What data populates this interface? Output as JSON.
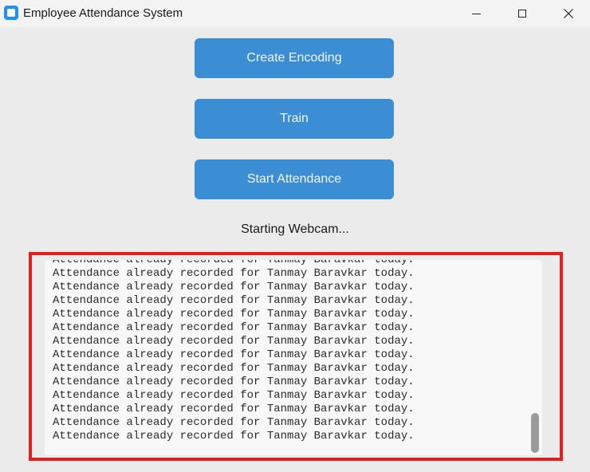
{
  "window": {
    "title": "Employee Attendance System",
    "icons": [
      "app-icon",
      "minimize-icon",
      "maximize-icon",
      "close-icon"
    ]
  },
  "buttons": {
    "create_encoding": "Create Encoding",
    "train": "Train",
    "start_attendance": "Start Attendance"
  },
  "status": "Starting Webcam...",
  "log": {
    "lines": [
      "Attendance already recorded for Tanmay Baravkar today.",
      "Attendance already recorded for Tanmay Baravkar today.",
      "Attendance already recorded for Tanmay Baravkar today.",
      "Attendance already recorded for Tanmay Baravkar today.",
      "Attendance already recorded for Tanmay Baravkar today.",
      "Attendance already recorded for Tanmay Baravkar today.",
      "Attendance already recorded for Tanmay Baravkar today.",
      "Attendance already recorded for Tanmay Baravkar today.",
      "Attendance already recorded for Tanmay Baravkar today.",
      "Attendance already recorded for Tanmay Baravkar today.",
      "Attendance already recorded for Tanmay Baravkar today.",
      "Attendance already recorded for Tanmay Baravkar today.",
      "Attendance already recorded for Tanmay Baravkar today.",
      "Attendance already recorded for Tanmay Baravkar today."
    ]
  },
  "colors": {
    "button": "#3b8ed4",
    "highlight": "#e0201e",
    "background": "#ebebeb"
  }
}
